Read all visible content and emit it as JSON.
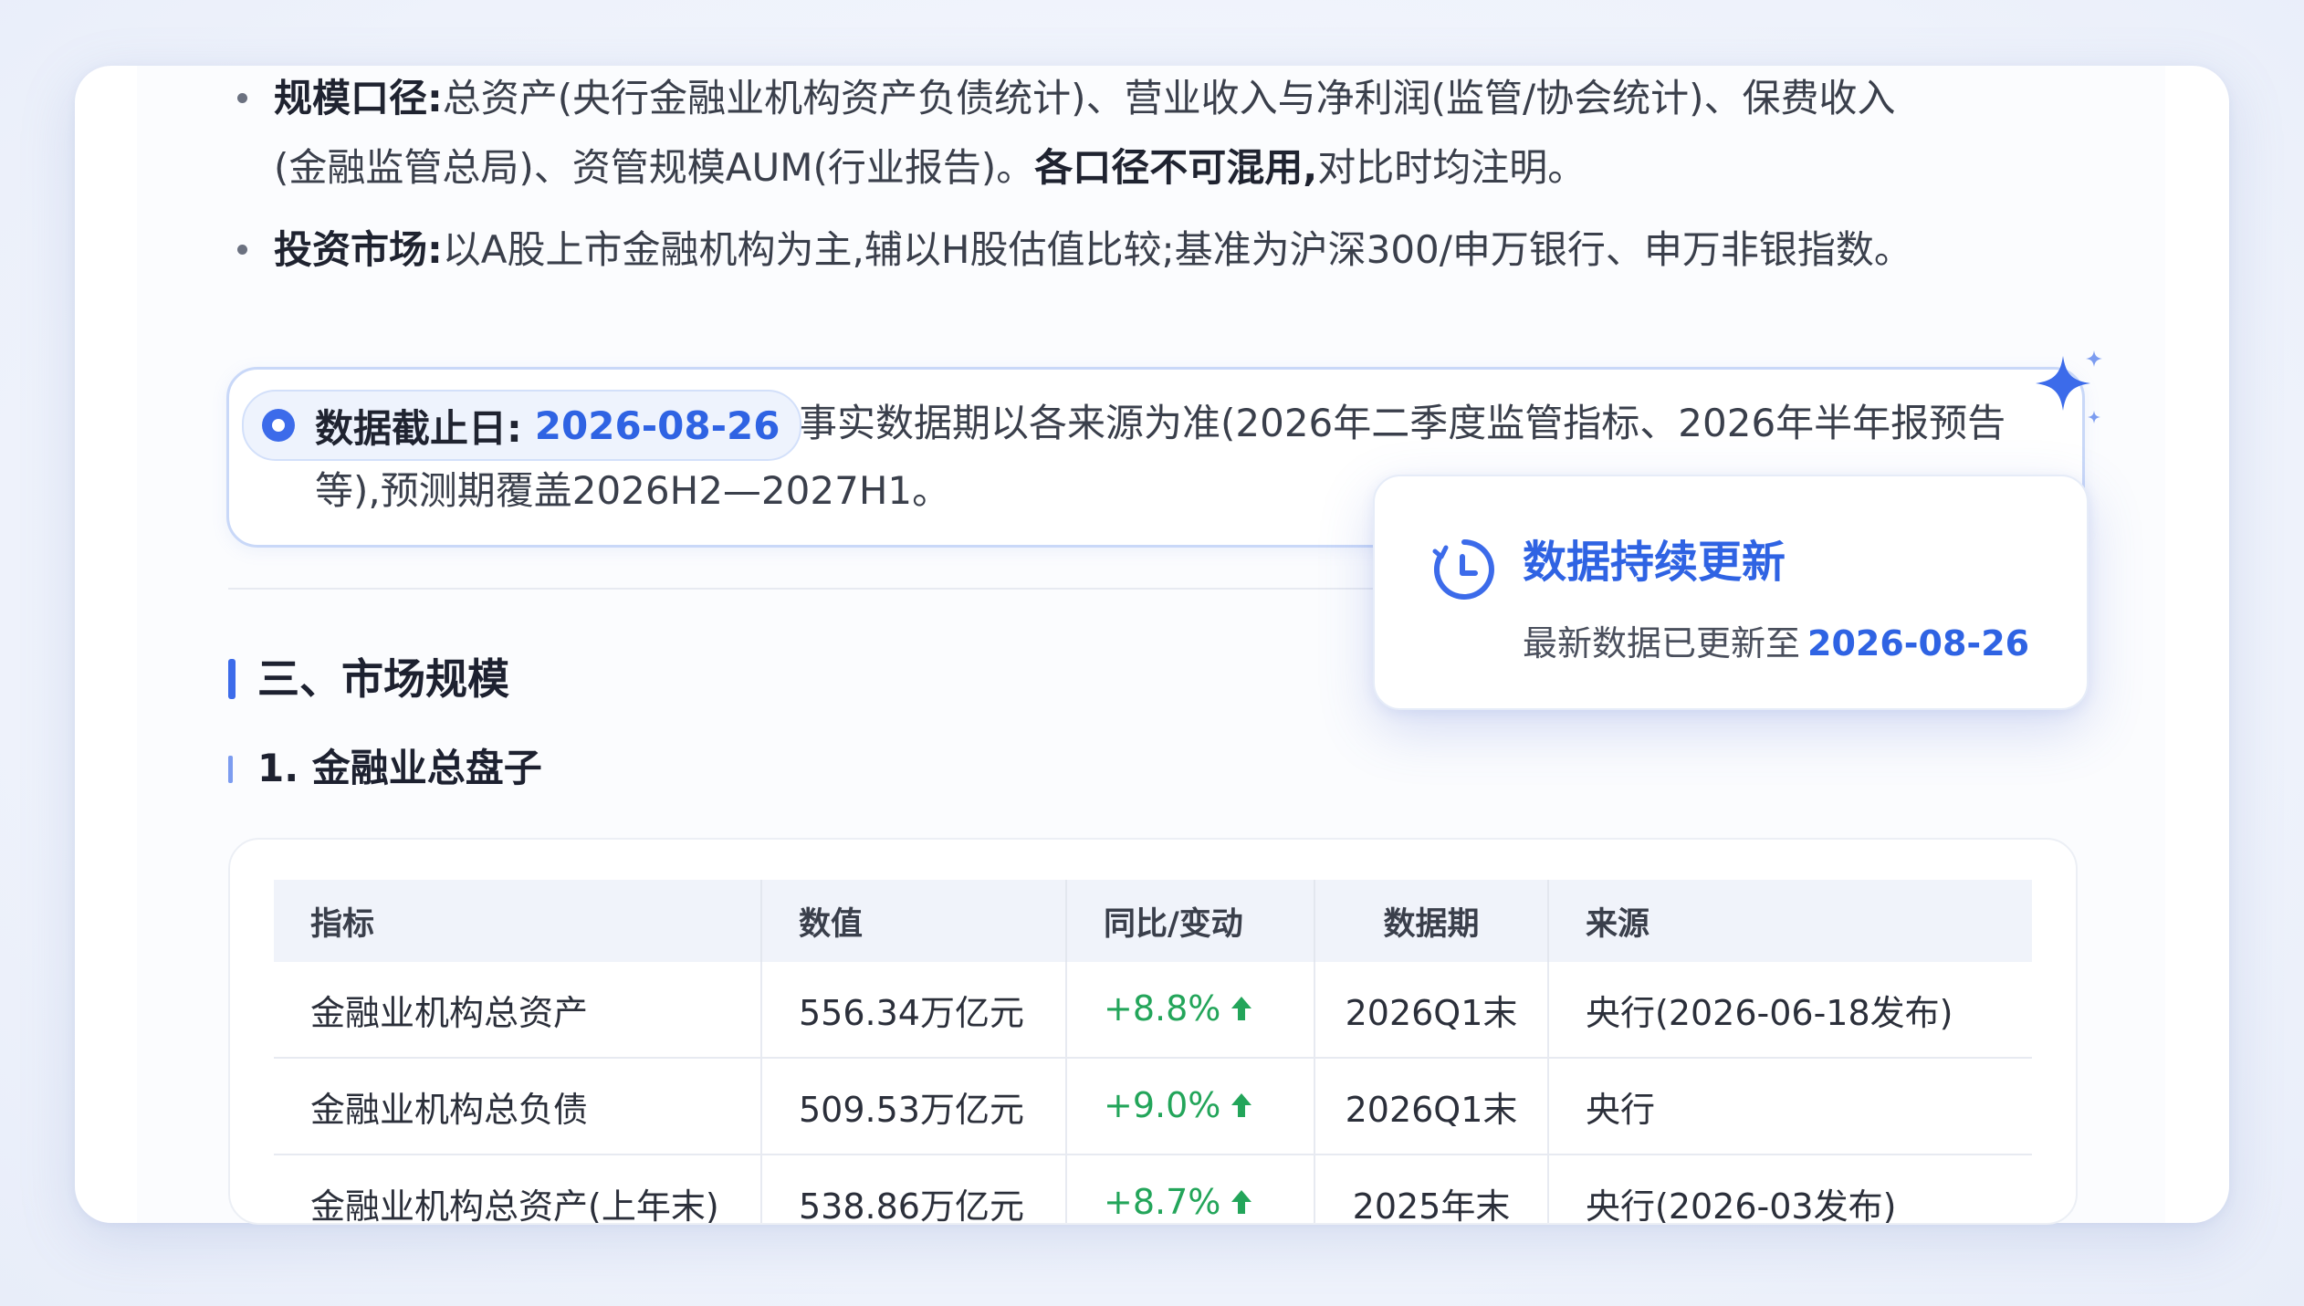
{
  "bullets": [
    {
      "label": "规模口径:",
      "text1": "总资产(央行金融业机构资产负债统计)、营业收入与净利润(监管/协会统计)、保费收入(金融监管总局)、资管规模AUM(行业报告)。",
      "bold": "各口径不可混用,",
      "text2": "对比时均注明。"
    },
    {
      "label": "投资市场:",
      "text1": "以A股上市金融机构为主,辅以H股估值比较;基准为沪深300/申万银行、申万非银指数。"
    }
  ],
  "notice": {
    "pill_label": "数据截止日:",
    "pill_date": "2026-08-26",
    "text": "事实数据期以各来源为准(2026年二季度监管指标、2026年半年报预告等),预测期覆盖2026H2—2027H1。"
  },
  "section": {
    "h2": "三、市场规模",
    "h3": "1. 金融业总盘子"
  },
  "table": {
    "headers": [
      "指标",
      "数值",
      "同比/变动",
      "数据期",
      "来源"
    ],
    "rows": [
      [
        "金融业机构总资产",
        "556.34万亿元",
        "+8.8%",
        "2026Q1末",
        "央行(2026-06-18发布)"
      ],
      [
        "金融业机构总负债",
        "509.53万亿元",
        "+9.0%",
        "2026Q1末",
        "央行"
      ],
      [
        "金融业机构总资产(上年末)",
        "538.86万亿元",
        "+8.7%",
        "2025年末",
        "央行(2026-03发布)"
      ]
    ]
  },
  "popup": {
    "title": "数据持续更新",
    "sub_label": "最新数据已更新至",
    "sub_date": "2026-08-26",
    "icon": "clock-icon"
  },
  "colors": {
    "accent": "#2f63e3",
    "up": "#23a55a"
  }
}
